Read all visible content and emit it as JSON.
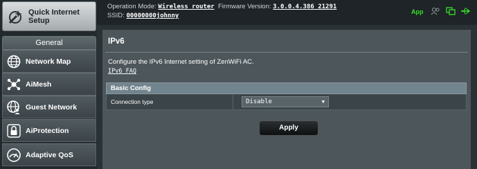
{
  "sidebar": {
    "quick_setup": {
      "label_line1": "Quick Internet",
      "label_line2": "Setup",
      "icon": "wand-icon"
    },
    "section_label": "General",
    "items": [
      {
        "label": "Network Map",
        "icon": "globe-icon"
      },
      {
        "label": "AiMesh",
        "icon": "mesh-icon"
      },
      {
        "label": "Guest Network",
        "icon": "guest-globe-icon"
      },
      {
        "label": "AiProtection",
        "icon": "lock-icon"
      },
      {
        "label": "Adaptive QoS",
        "icon": "gauge-icon"
      }
    ]
  },
  "topbar": {
    "operation_mode_label": "Operation Mode:",
    "operation_mode_value": "Wireless router",
    "firmware_label": "Firmware Version:",
    "firmware_value": "3.0.0.4.386_21291",
    "ssid_label": "SSID:",
    "ssid_value": "00000000johnny",
    "app_label": "App",
    "status_icons": [
      "user-icon",
      "copy-icon",
      "usb-icon"
    ],
    "accent": "#39e029"
  },
  "main": {
    "title": "IPv6",
    "description": "Configure the IPv6 Internet setting of ZenWiFi AC.",
    "faq_link": "IPv6 FAQ",
    "section_header": "Basic Config",
    "fields": [
      {
        "label": "Connection type",
        "value": "Disable"
      }
    ],
    "apply_label": "Apply"
  }
}
